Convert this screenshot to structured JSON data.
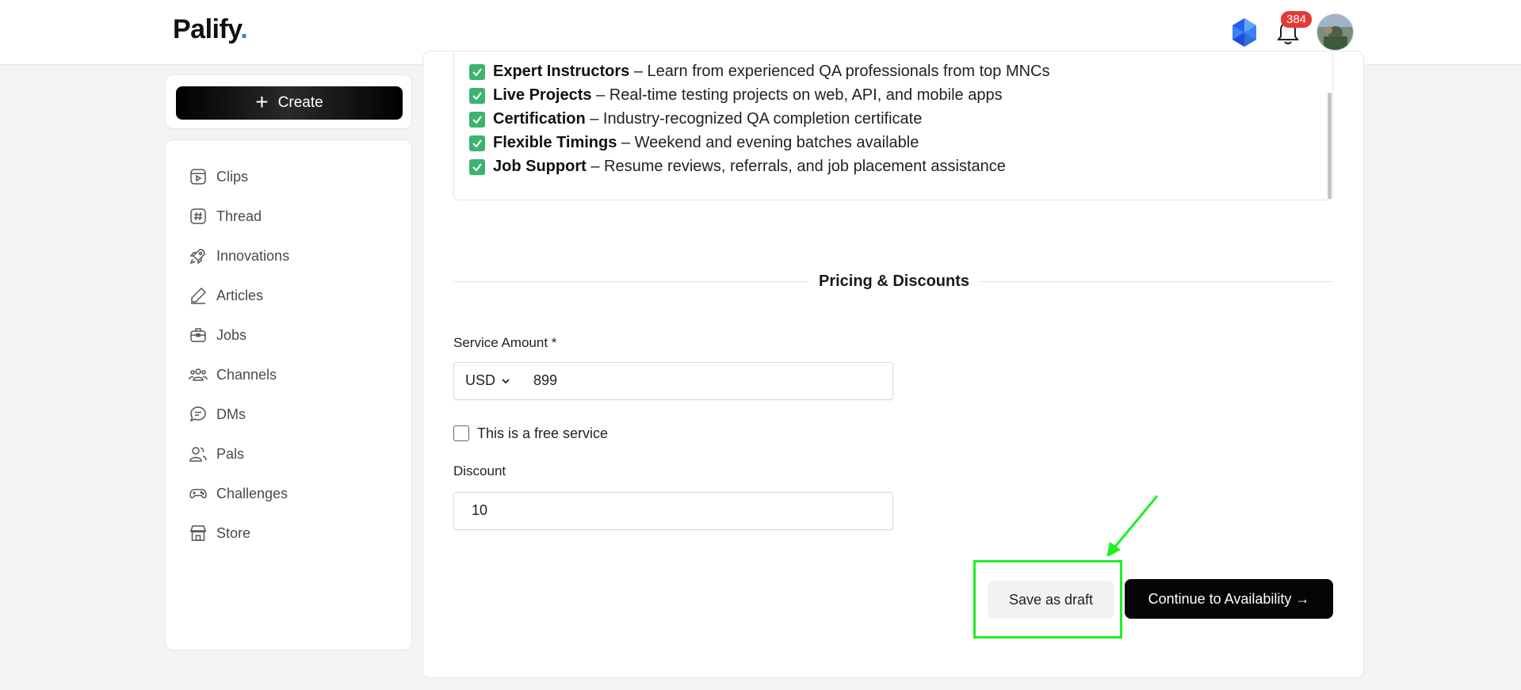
{
  "header": {
    "brand": "Palify",
    "brand_dot": ".",
    "notification_count": "384"
  },
  "create": {
    "label": "Create"
  },
  "sidebar": {
    "items": [
      {
        "label": "Clips",
        "icon": "clips-icon"
      },
      {
        "label": "Thread",
        "icon": "hash-icon"
      },
      {
        "label": "Innovations",
        "icon": "rocket-icon"
      },
      {
        "label": "Articles",
        "icon": "pen-icon"
      },
      {
        "label": "Jobs",
        "icon": "briefcase-icon"
      },
      {
        "label": "Channels",
        "icon": "people-icon"
      },
      {
        "label": "DMs",
        "icon": "chat-icon"
      },
      {
        "label": "Pals",
        "icon": "pals-icon"
      },
      {
        "label": "Challenges",
        "icon": "gamepad-icon"
      },
      {
        "label": "Store",
        "icon": "store-icon"
      }
    ]
  },
  "features": [
    {
      "title": "Expert Instructors",
      "text": " – Learn from experienced QA professionals from top MNCs"
    },
    {
      "title": "Live Projects",
      "text": " – Real-time testing projects on web, API, and mobile apps"
    },
    {
      "title": "Certification",
      "text": " – Industry-recognized QA completion certificate"
    },
    {
      "title": "Flexible Timings",
      "text": " – Weekend and evening batches available"
    },
    {
      "title": "Job Support",
      "text": " – Resume reviews, referrals, and job placement assistance"
    }
  ],
  "pricing": {
    "section_title": "Pricing & Discounts",
    "amount_label": "Service Amount *",
    "currency": "USD",
    "amount": "899",
    "free_label": "This is a free service",
    "free_checked": false,
    "discount_label": "Discount",
    "discount": "10"
  },
  "actions": {
    "draft": "Save as draft",
    "continue": "Continue to Availability →"
  },
  "colors": {
    "accent_check": "#3cb371",
    "badge": "#e53935",
    "highlight": "#20f020",
    "primary_button": "#050505"
  }
}
